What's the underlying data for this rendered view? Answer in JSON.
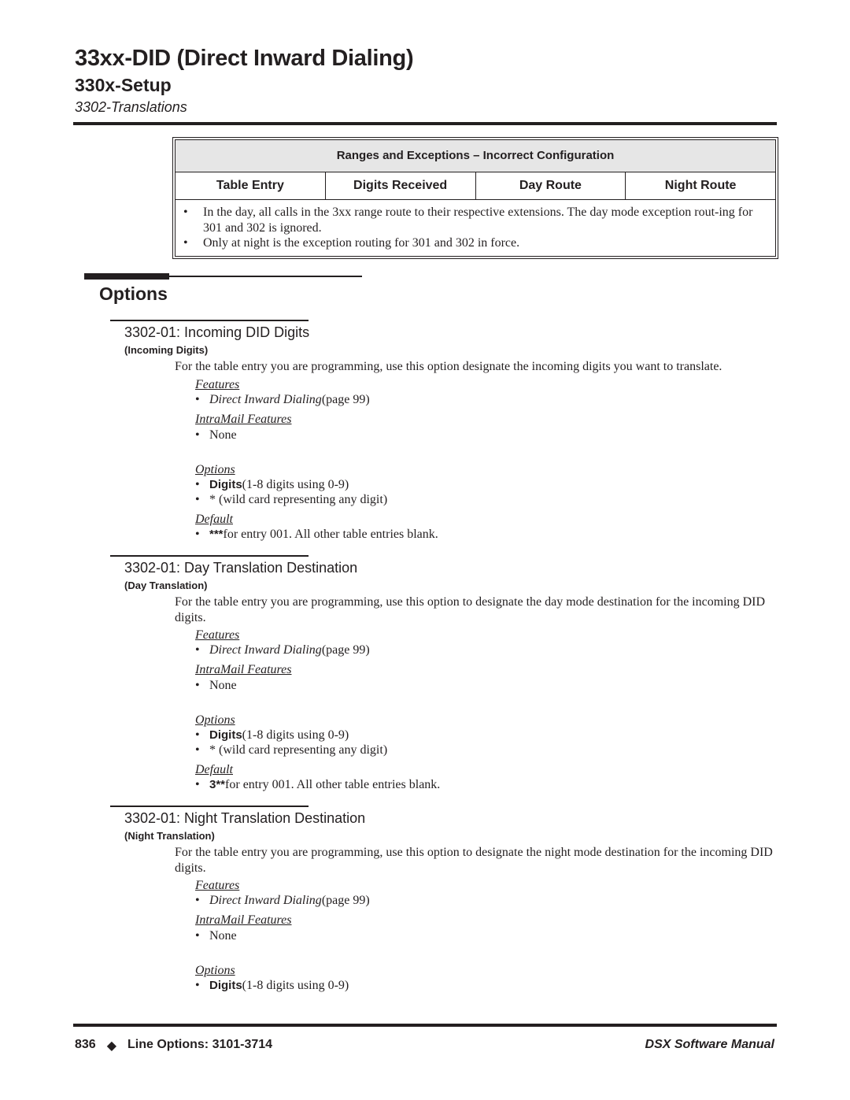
{
  "header": {
    "chapter_title": "33xx-DID (Direct Inward Dialing)",
    "section_title": "330x-Setup",
    "subsection_title": "3302-Translations"
  },
  "table": {
    "title": "Ranges and Exceptions – Incorrect Configuration",
    "columns": [
      "Table Entry",
      "Digits Received",
      "Day Route",
      "Night Route"
    ],
    "notes": [
      "In the day, all calls in the 3xx range route to their respective extensions. The day mode exception rout-ing for 301 and 302 is ignored.",
      "Only at night is the exception routing for 301 and 302 in force."
    ]
  },
  "options_heading": "Options",
  "sections": [
    {
      "title": "3302-01: Incoming DID Digits",
      "tag": "(Incoming Digits)",
      "description": "For the table entry you are programming, use this option designate the incoming digits you want to translate.",
      "features_label": "Features",
      "features": [
        {
          "link": "Direct Inward Dialing",
          "suffix": " (page 99)"
        }
      ],
      "intramail_label": "IntraMail Features",
      "intramail": [
        "None"
      ],
      "options_label": "Options",
      "options": [
        {
          "bold": "Digits",
          "text": " (1-8 digits using 0-9)"
        },
        {
          "bold": "",
          "text": "* (wild card representing any digit)"
        }
      ],
      "default_label": "Default",
      "default": [
        {
          "bold": "***",
          "text": " for entry 001. All other table entries blank."
        }
      ]
    },
    {
      "title": "3302-01: Day Translation Destination",
      "tag": "(Day Translation)",
      "description": "For the table entry you are programming, use this option to designate the day mode destination for the incoming DID digits.",
      "features_label": "Features",
      "features": [
        {
          "link": "Direct Inward Dialing",
          "suffix": " (page 99)"
        }
      ],
      "intramail_label": "IntraMail Features",
      "intramail": [
        "None"
      ],
      "options_label": "Options",
      "options": [
        {
          "bold": "Digits",
          "text": " (1-8 digits using 0-9)"
        },
        {
          "bold": "",
          "text": "* (wild card representing any digit)"
        }
      ],
      "default_label": "Default",
      "default": [
        {
          "bold": "3**",
          "text": " for entry 001. All other table entries blank."
        }
      ]
    },
    {
      "title": "3302-01: Night Translation Destination",
      "tag": "(Night Translation)",
      "description": "For the table entry you are programming, use this option to designate the night mode destination for the incoming DID digits.",
      "features_label": "Features",
      "features": [
        {
          "link": "Direct Inward Dialing",
          "suffix": " (page 99)"
        }
      ],
      "intramail_label": "IntraMail Features",
      "intramail": [
        "None"
      ],
      "options_label": "Options",
      "options": [
        {
          "bold": "Digits",
          "text": " (1-8 digits using 0-9)"
        }
      ]
    }
  ],
  "footer": {
    "page_number": "836",
    "separator_icon": "diamond",
    "section_ref": "Line Options: 3101-3714",
    "manual_title": "DSX Software Manual"
  }
}
